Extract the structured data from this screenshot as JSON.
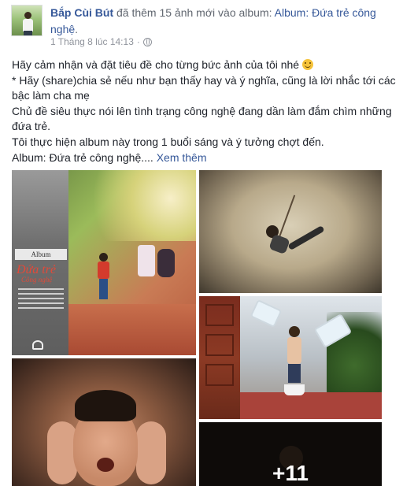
{
  "post": {
    "author": "Bắp Cùi Bút",
    "action": " đã thêm 15 ảnh mới vào album: ",
    "album_link": "Album: Đứa trẻ công nghệ",
    "album_link_tail": ".",
    "timestamp": "1 Tháng 8 lúc 14:13",
    "separator": "·",
    "privacy_icon": "globe-icon",
    "body_lines": [
      "Hãy cảm nhận và đặt tiêu đề cho từng bức ảnh của tôi nhé",
      "* Hãy (share)chia sẻ nếu như bạn thấy hay và ý nghĩa, cũng là lời nhắc tới các bậc làm cha mẹ",
      "Chủ đề siêu thực nói lên tình trạng công nghệ đang dần làm đắm chìm những đứa trẻ.",
      "Tôi thực hiện album này trong 1 buổi sáng và ý tưởng chợt đến.",
      "Album: Đứa trẻ công nghệ...."
    ],
    "see_more": "Xem thêm",
    "emoji": "smiley"
  },
  "photos": {
    "cover_label": "Album",
    "cover_title": "Đứa trẻ",
    "cover_subtitle": "Công nghệ",
    "more_count": "+11"
  },
  "colors": {
    "link": "#365899",
    "meta": "#90949c",
    "text": "#1d2129"
  }
}
